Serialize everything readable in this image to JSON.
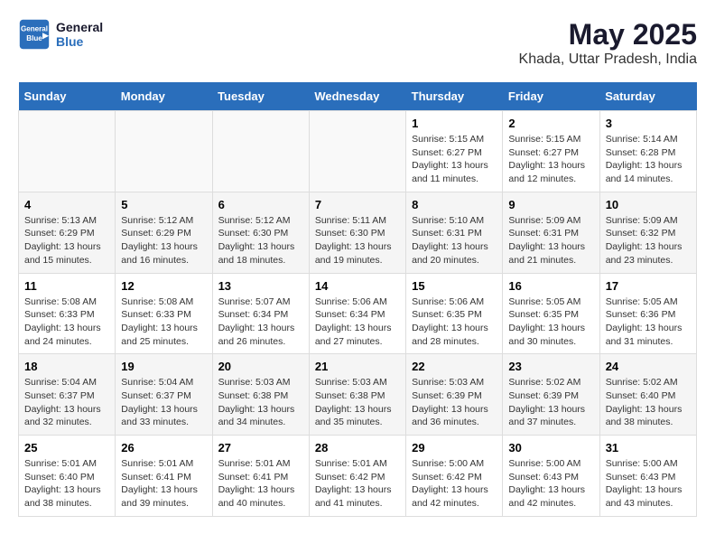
{
  "header": {
    "logo_line1": "General",
    "logo_line2": "Blue",
    "title": "May 2025",
    "subtitle": "Khada, Uttar Pradesh, India"
  },
  "weekdays": [
    "Sunday",
    "Monday",
    "Tuesday",
    "Wednesday",
    "Thursday",
    "Friday",
    "Saturday"
  ],
  "weeks": [
    [
      {
        "day": "",
        "info": ""
      },
      {
        "day": "",
        "info": ""
      },
      {
        "day": "",
        "info": ""
      },
      {
        "day": "",
        "info": ""
      },
      {
        "day": "1",
        "info": "Sunrise: 5:15 AM\nSunset: 6:27 PM\nDaylight: 13 hours\nand 11 minutes."
      },
      {
        "day": "2",
        "info": "Sunrise: 5:15 AM\nSunset: 6:27 PM\nDaylight: 13 hours\nand 12 minutes."
      },
      {
        "day": "3",
        "info": "Sunrise: 5:14 AM\nSunset: 6:28 PM\nDaylight: 13 hours\nand 14 minutes."
      }
    ],
    [
      {
        "day": "4",
        "info": "Sunrise: 5:13 AM\nSunset: 6:29 PM\nDaylight: 13 hours\nand 15 minutes."
      },
      {
        "day": "5",
        "info": "Sunrise: 5:12 AM\nSunset: 6:29 PM\nDaylight: 13 hours\nand 16 minutes."
      },
      {
        "day": "6",
        "info": "Sunrise: 5:12 AM\nSunset: 6:30 PM\nDaylight: 13 hours\nand 18 minutes."
      },
      {
        "day": "7",
        "info": "Sunrise: 5:11 AM\nSunset: 6:30 PM\nDaylight: 13 hours\nand 19 minutes."
      },
      {
        "day": "8",
        "info": "Sunrise: 5:10 AM\nSunset: 6:31 PM\nDaylight: 13 hours\nand 20 minutes."
      },
      {
        "day": "9",
        "info": "Sunrise: 5:09 AM\nSunset: 6:31 PM\nDaylight: 13 hours\nand 21 minutes."
      },
      {
        "day": "10",
        "info": "Sunrise: 5:09 AM\nSunset: 6:32 PM\nDaylight: 13 hours\nand 23 minutes."
      }
    ],
    [
      {
        "day": "11",
        "info": "Sunrise: 5:08 AM\nSunset: 6:33 PM\nDaylight: 13 hours\nand 24 minutes."
      },
      {
        "day": "12",
        "info": "Sunrise: 5:08 AM\nSunset: 6:33 PM\nDaylight: 13 hours\nand 25 minutes."
      },
      {
        "day": "13",
        "info": "Sunrise: 5:07 AM\nSunset: 6:34 PM\nDaylight: 13 hours\nand 26 minutes."
      },
      {
        "day": "14",
        "info": "Sunrise: 5:06 AM\nSunset: 6:34 PM\nDaylight: 13 hours\nand 27 minutes."
      },
      {
        "day": "15",
        "info": "Sunrise: 5:06 AM\nSunset: 6:35 PM\nDaylight: 13 hours\nand 28 minutes."
      },
      {
        "day": "16",
        "info": "Sunrise: 5:05 AM\nSunset: 6:35 PM\nDaylight: 13 hours\nand 30 minutes."
      },
      {
        "day": "17",
        "info": "Sunrise: 5:05 AM\nSunset: 6:36 PM\nDaylight: 13 hours\nand 31 minutes."
      }
    ],
    [
      {
        "day": "18",
        "info": "Sunrise: 5:04 AM\nSunset: 6:37 PM\nDaylight: 13 hours\nand 32 minutes."
      },
      {
        "day": "19",
        "info": "Sunrise: 5:04 AM\nSunset: 6:37 PM\nDaylight: 13 hours\nand 33 minutes."
      },
      {
        "day": "20",
        "info": "Sunrise: 5:03 AM\nSunset: 6:38 PM\nDaylight: 13 hours\nand 34 minutes."
      },
      {
        "day": "21",
        "info": "Sunrise: 5:03 AM\nSunset: 6:38 PM\nDaylight: 13 hours\nand 35 minutes."
      },
      {
        "day": "22",
        "info": "Sunrise: 5:03 AM\nSunset: 6:39 PM\nDaylight: 13 hours\nand 36 minutes."
      },
      {
        "day": "23",
        "info": "Sunrise: 5:02 AM\nSunset: 6:39 PM\nDaylight: 13 hours\nand 37 minutes."
      },
      {
        "day": "24",
        "info": "Sunrise: 5:02 AM\nSunset: 6:40 PM\nDaylight: 13 hours\nand 38 minutes."
      }
    ],
    [
      {
        "day": "25",
        "info": "Sunrise: 5:01 AM\nSunset: 6:40 PM\nDaylight: 13 hours\nand 38 minutes."
      },
      {
        "day": "26",
        "info": "Sunrise: 5:01 AM\nSunset: 6:41 PM\nDaylight: 13 hours\nand 39 minutes."
      },
      {
        "day": "27",
        "info": "Sunrise: 5:01 AM\nSunset: 6:41 PM\nDaylight: 13 hours\nand 40 minutes."
      },
      {
        "day": "28",
        "info": "Sunrise: 5:01 AM\nSunset: 6:42 PM\nDaylight: 13 hours\nand 41 minutes."
      },
      {
        "day": "29",
        "info": "Sunrise: 5:00 AM\nSunset: 6:42 PM\nDaylight: 13 hours\nand 42 minutes."
      },
      {
        "day": "30",
        "info": "Sunrise: 5:00 AM\nSunset: 6:43 PM\nDaylight: 13 hours\nand 42 minutes."
      },
      {
        "day": "31",
        "info": "Sunrise: 5:00 AM\nSunset: 6:43 PM\nDaylight: 13 hours\nand 43 minutes."
      }
    ]
  ]
}
